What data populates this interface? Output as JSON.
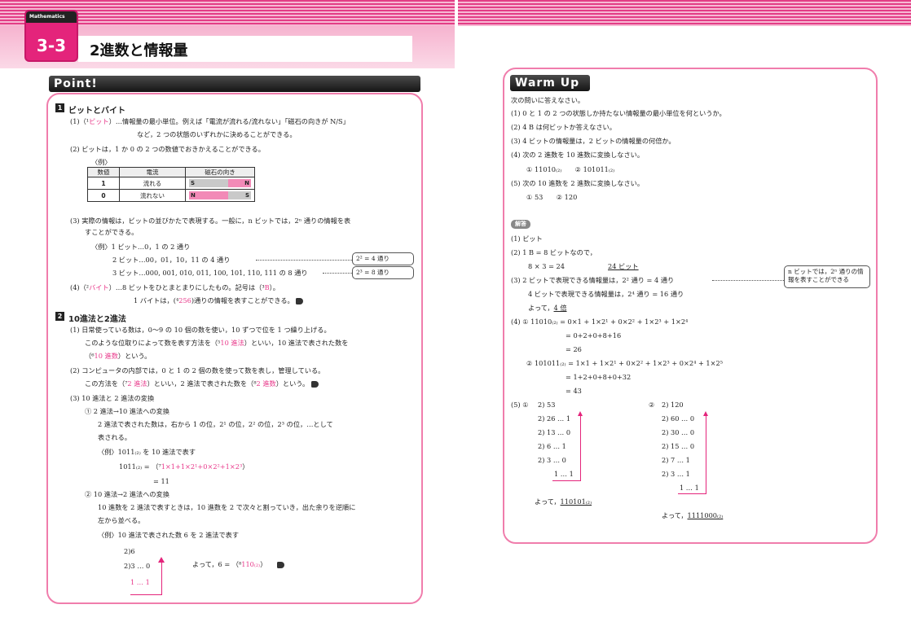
{
  "header": {
    "subject_tag": "Mathematics",
    "section_number": "3-3",
    "title": "2進数と情報量"
  },
  "point": {
    "ribbon": "Point!",
    "s1_num": "1",
    "s1_title": "ビットとバイト",
    "l1a": "(1)（¹",
    "l1b": "ビット",
    "l1c": "）…情報量の最小単位。例えば「電流が流れる/流れない」「磁石の向きが N/S」",
    "l2": "など，2 つの状態のいずれかに決めることができる。",
    "l3": "(2) ビットは，1 か 0 の 2 つの数値でおきかえることができる。",
    "ex1": "〈例〉",
    "table_headers": [
      "数値",
      "電流",
      "磁石の向き"
    ],
    "table_rows": [
      {
        "num": "1",
        "current": "流れる",
        "magnet_left": "S",
        "magnet_right": "N"
      },
      {
        "num": "0",
        "current": "流れない",
        "magnet_left": "N",
        "magnet_right": "S"
      }
    ],
    "l4": "(3) 実際の情報は，ビットの並びかたで表現する。一般に，n ビットでは，2ⁿ 通りの情報を表",
    "l5": "すことができる。",
    "l6": "〈例〉1 ビット…0，1 の 2 通り",
    "l7": "2 ビット…00，01，10，11 の 4 通り",
    "l8": "3 ビット…000, 001, 010, 011, 100, 101, 110, 111 の 8 通り",
    "callout1": "2² = 4 通り",
    "callout2": "2³ = 8 通り",
    "l9a": "(4)（²",
    "l9b": "バイト",
    "l9c": "）…8 ビットをひとまとまりにしたもの。記号は（³",
    "l9d": "B",
    "l9e": "）。",
    "l10a": "1 バイトは，(⁴",
    "l10b": "256",
    "l10c": ")通りの情報を表すことができる。",
    "s2_num": "2",
    "s2_title": "10進法と2進法",
    "m1": "(1) 日常使っている数は，0〜9 の 10 個の数を使い，10 ずつで位を 1 つ繰り上げる。",
    "m2a": "このような位取りによって数を表す方法を（⁵",
    "m2b": "10 進法",
    "m2c": "）といい，10 進法で表された数を",
    "m3a": "（⁶",
    "m3b": "10 進数",
    "m3c": "）という。",
    "m4": "(2) コンピュータの内部では，0 と 1 の 2 個の数を使って数を表し，管理している。",
    "m5a": "この方法を（⁷",
    "m5b": "2 進法",
    "m5c": "）といい，2 進法で表された数を（⁸",
    "m5d": "2 進数",
    "m5e": "）という。",
    "m6": "(3) 10 進法と 2 進法の変換",
    "m7": "① 2 進法→10 進法への変換",
    "m8": "2 進法で表された数は，右から 1 の位，2¹ の位，2² の位，2³ の位，…として",
    "m9": "表される。",
    "m10": "〈例〉1011₍₂₎ を 10 進法で表す",
    "m11a": "1011₍₂₎ = （⁷",
    "m11b": "1×1+1×2¹+0×2²+1×2³",
    "m11c": "）",
    "m12": "= 11",
    "m13": "② 10 進法→2 進法への変換",
    "m14": "10 進数を 2 進法で表すときは，10 進数を 2 で次々と割っていき，出た余りを逆順に",
    "m15": "左から並べる。",
    "m16": "〈例〉10 進法で表された数 6 を 2 進法で表す",
    "d1": "2)6",
    "d2": "2)3 … 0",
    "d3": "1 … 1",
    "m17a": "よって，6 = （⁸",
    "m17b": "110₍₂₎",
    "m17c": "）"
  },
  "warmup": {
    "ribbon": "Warm Up",
    "q0": "次の問いに答えなさい。",
    "q1": "(1) 0 と 1 の 2 つの状態しか持たない情報量の最小単位を何というか。",
    "q2": "(2) 4 B は何ビットか答えなさい。",
    "q3": "(3) 4 ビットの情報量は，2 ビットの情報量の何倍か。",
    "q4": "(4) 次の 2 進数を 10 進数に変換しなさい。",
    "q4s": "① 11010₍₂₎　　② 101011₍₂₎",
    "q5": "(5) 次の 10 進数を 2 進数に変換しなさい。",
    "q5s": "① 53　　② 120",
    "answer_badge": "解答",
    "a1": "(1) ビット",
    "a2": "(2) 1 B = 8 ビットなので，",
    "a2b": "8 × 3 = 24",
    "a2c": "24 ビット",
    "a3": "(3) 2 ビットで表現できる情報量は，2² 通り = 4 通り",
    "a3b": "4 ビットで表現できる情報量は，2⁴ 通り = 16 通り",
    "a3c": "よって，",
    "a3d": "4 倍",
    "callout": "n ビットでは，2ⁿ 通りの情報を表すことができる",
    "a4a": "(4) ① 11010₍₂₎ = 0×1 + 1×2¹ + 0×2² + 1×2³ + 1×2⁴",
    "a4b": "= 0+2+0+8+16",
    "a4c": "= 26",
    "a4d": "② 101011₍₂₎ = 1×1 + 1×2¹ + 0×2² + 1×2³ + 0×2⁴ + 1×2⁵",
    "a4e": "= 1+2+0+8+0+32",
    "a4f": "= 43",
    "a5": "(5) ①",
    "div1": [
      "2) 53",
      "2) 26 … 1",
      "2) 13 … 0",
      "2)  6 … 1",
      "2)  3 … 0",
      "1 … 1"
    ],
    "div2_label": "②",
    "div2": [
      "2) 120",
      "2)  60 … 0",
      "2)  30 … 0",
      "2)  15 … 0",
      "2)   7 … 1",
      "2)   3 … 1",
      "1 … 1"
    ],
    "res1a": "よって，",
    "res1b": "110101₍₂₎",
    "res2a": "よって，",
    "res2b": "1111000₍₂₎"
  }
}
